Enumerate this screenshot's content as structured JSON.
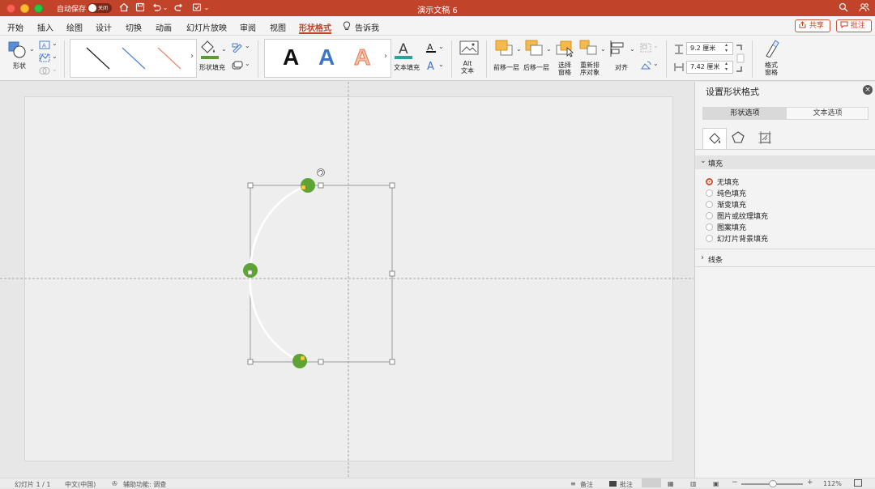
{
  "titlebar": {
    "autosave_label": "自动保存",
    "autosave_state": "关闭",
    "document_title": "演示文稿 6",
    "colors": {
      "bar": "#c0432a"
    }
  },
  "menu": {
    "tabs": [
      "开始",
      "插入",
      "绘图",
      "设计",
      "切换",
      "动画",
      "幻灯片放映",
      "审阅",
      "视图",
      "形状格式"
    ],
    "active_tab": "形状格式",
    "tell_me": "告诉我",
    "share_label": "共享",
    "comments_label": "批注"
  },
  "ribbon": {
    "shapes_label": "形状",
    "shape_fill_label": "形状填充",
    "text_fill_label": "文本填充",
    "alt_text_label": "Alt\n文本",
    "bring_forward_label": "前移一层",
    "send_backward_label": "后移一层",
    "selection_pane_label": "选择\n窗格",
    "reorder_objects_label": "重新排\n序对象",
    "align_label": "对齐",
    "height_value": "9.2 厘米",
    "width_value": "7.42 厘米",
    "format_pane_label": "格式\n窗格",
    "wordart_letters": [
      "A",
      "A",
      "A"
    ]
  },
  "pane": {
    "title": "设置形状格式",
    "tabs": [
      "形状选项",
      "文本选项"
    ],
    "active_tab": "形状选项",
    "fill_section": "填充",
    "fill_options": [
      {
        "label": "无填充",
        "selected": true
      },
      {
        "label": "纯色填充",
        "selected": false
      },
      {
        "label": "渐变填充",
        "selected": false
      },
      {
        "label": "图片或纹理填充",
        "selected": false
      },
      {
        "label": "图案填充",
        "selected": false
      },
      {
        "label": "幻灯片背景填充",
        "selected": false
      }
    ],
    "line_section": "线条"
  },
  "status": {
    "slide_counter": "幻灯片 1 / 1",
    "language": "中文(中国)",
    "accessibility": "辅助功能: 调查",
    "notes_label": "备注",
    "comments_label": "批注",
    "zoom": "112%"
  },
  "icons": [
    "close-icon",
    "minimize-icon",
    "maximize-icon",
    "home-icon",
    "save-icon",
    "undo-icon",
    "redo-icon",
    "search-icon",
    "people-icon",
    "lightbulb-icon",
    "share-icon",
    "comment-icon",
    "paint-bucket-icon",
    "pentagon-icon",
    "size-properties-icon",
    "rotate-icon"
  ]
}
